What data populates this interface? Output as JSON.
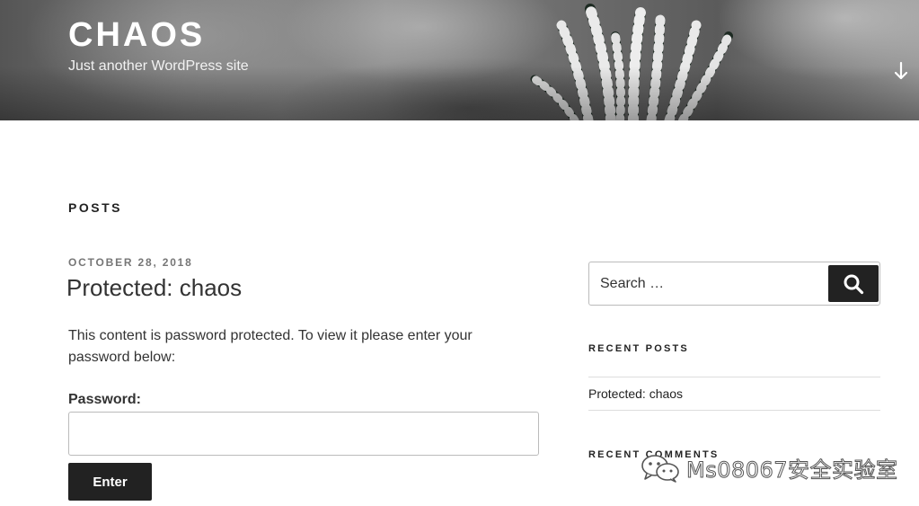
{
  "header": {
    "site_title": "CHAOS",
    "site_description": "Just another WordPress site"
  },
  "main": {
    "section_title": "POSTS",
    "post": {
      "date": "OCTOBER 28, 2018",
      "title": "Protected: chaos",
      "text": "This content is password protected. To view it please enter your password below:",
      "password_label": "Password:",
      "password_value": "",
      "submit_label": "Enter"
    }
  },
  "sidebar": {
    "search": {
      "placeholder": "Search …",
      "button_icon": "search-icon"
    },
    "recent_posts": {
      "title": "RECENT POSTS",
      "items": [
        {
          "label": "Protected: chaos"
        }
      ]
    },
    "recent_comments": {
      "title": "RECENT COMMENTS"
    }
  },
  "watermark": {
    "text": "Ms08067安全实验室",
    "icon": "wechat-icon"
  },
  "colors": {
    "button_bg": "#222222",
    "header_text": "#ffffff",
    "meta_gray": "#767676"
  }
}
